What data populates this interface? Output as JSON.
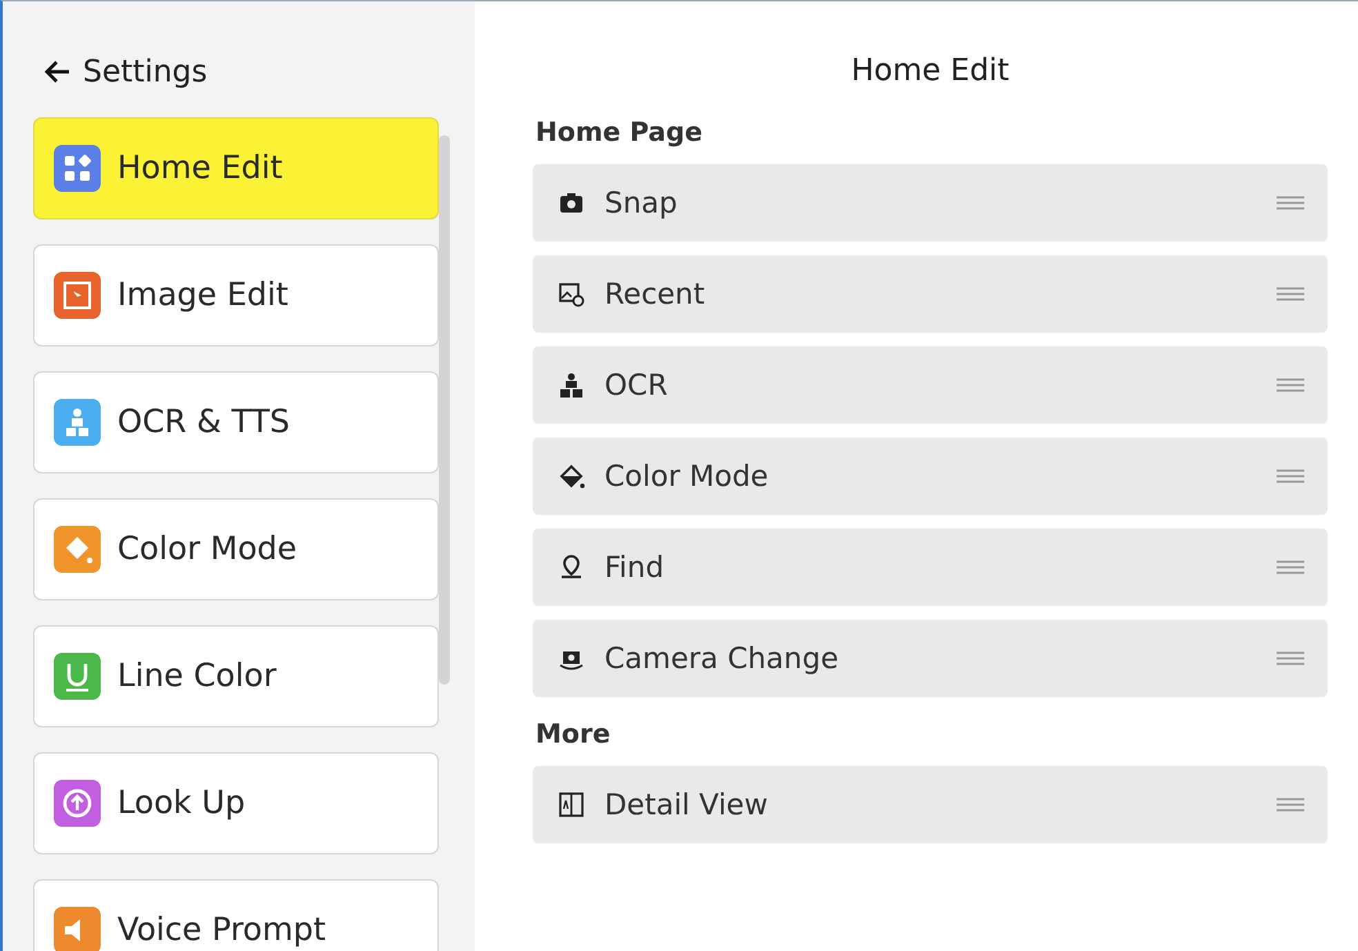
{
  "back": {
    "label": "Settings"
  },
  "sidebar": {
    "items": [
      {
        "label": "Home Edit",
        "selected": true,
        "color": "#5b7fe6"
      },
      {
        "label": "Image Edit",
        "selected": false,
        "color": "#e8622c"
      },
      {
        "label": "OCR & TTS",
        "selected": false,
        "color": "#4aaef0"
      },
      {
        "label": "Color Mode",
        "selected": false,
        "color": "#f0952a"
      },
      {
        "label": "Line Color",
        "selected": false,
        "color": "#4cb84a"
      },
      {
        "label": "Look Up",
        "selected": false,
        "color": "#c25ee0"
      },
      {
        "label": "Voice Prompt",
        "selected": false,
        "color": "#ee8a2e"
      }
    ]
  },
  "page": {
    "title": "Home Edit",
    "sections": [
      {
        "heading": "Home Page",
        "rows": [
          {
            "label": "Snap",
            "kind": "camera"
          },
          {
            "label": "Recent",
            "kind": "gallery"
          },
          {
            "label": "OCR",
            "kind": "ocr"
          },
          {
            "label": "Color Mode",
            "kind": "bucket"
          },
          {
            "label": "Find",
            "kind": "pin"
          },
          {
            "label": "Camera Change",
            "kind": "switch"
          }
        ]
      },
      {
        "heading": "More",
        "rows": [
          {
            "label": "Detail View",
            "kind": "detail"
          }
        ]
      }
    ]
  }
}
